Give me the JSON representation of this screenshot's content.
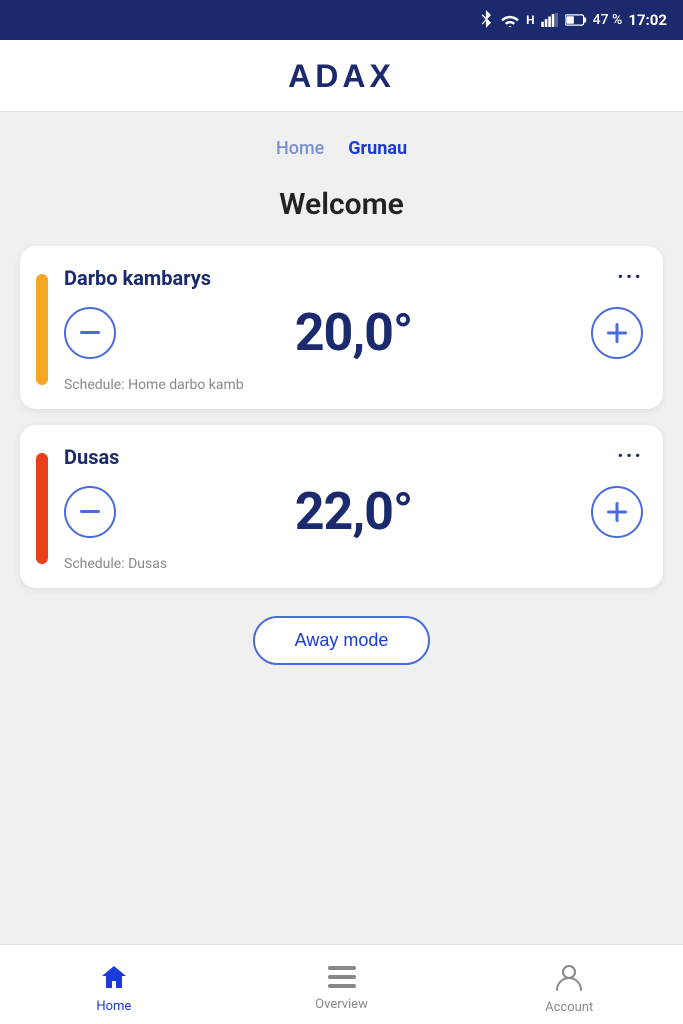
{
  "status_bar": {
    "battery": "47 %",
    "time": "17:02",
    "icons": [
      "bluetooth",
      "wifi",
      "signal",
      "battery"
    ]
  },
  "app": {
    "logo": "ADAX"
  },
  "location_tabs": [
    {
      "label": "Home",
      "active": false
    },
    {
      "label": "Grunau",
      "active": true
    }
  ],
  "welcome": {
    "title": "Welcome"
  },
  "rooms": [
    {
      "name": "Darbo kambarys",
      "temperature": "20,0°",
      "schedule": "Schedule: Home darbo kamb",
      "accent": "yellow"
    },
    {
      "name": "Dusas",
      "temperature": "22,0°",
      "schedule": "Schedule: Dusas",
      "accent": "orange"
    }
  ],
  "away_mode": {
    "label": "Away mode"
  },
  "bottom_nav": [
    {
      "label": "Home",
      "icon": "home",
      "active": true
    },
    {
      "label": "Overview",
      "icon": "list",
      "active": false
    },
    {
      "label": "Account",
      "icon": "account",
      "active": false
    }
  ]
}
